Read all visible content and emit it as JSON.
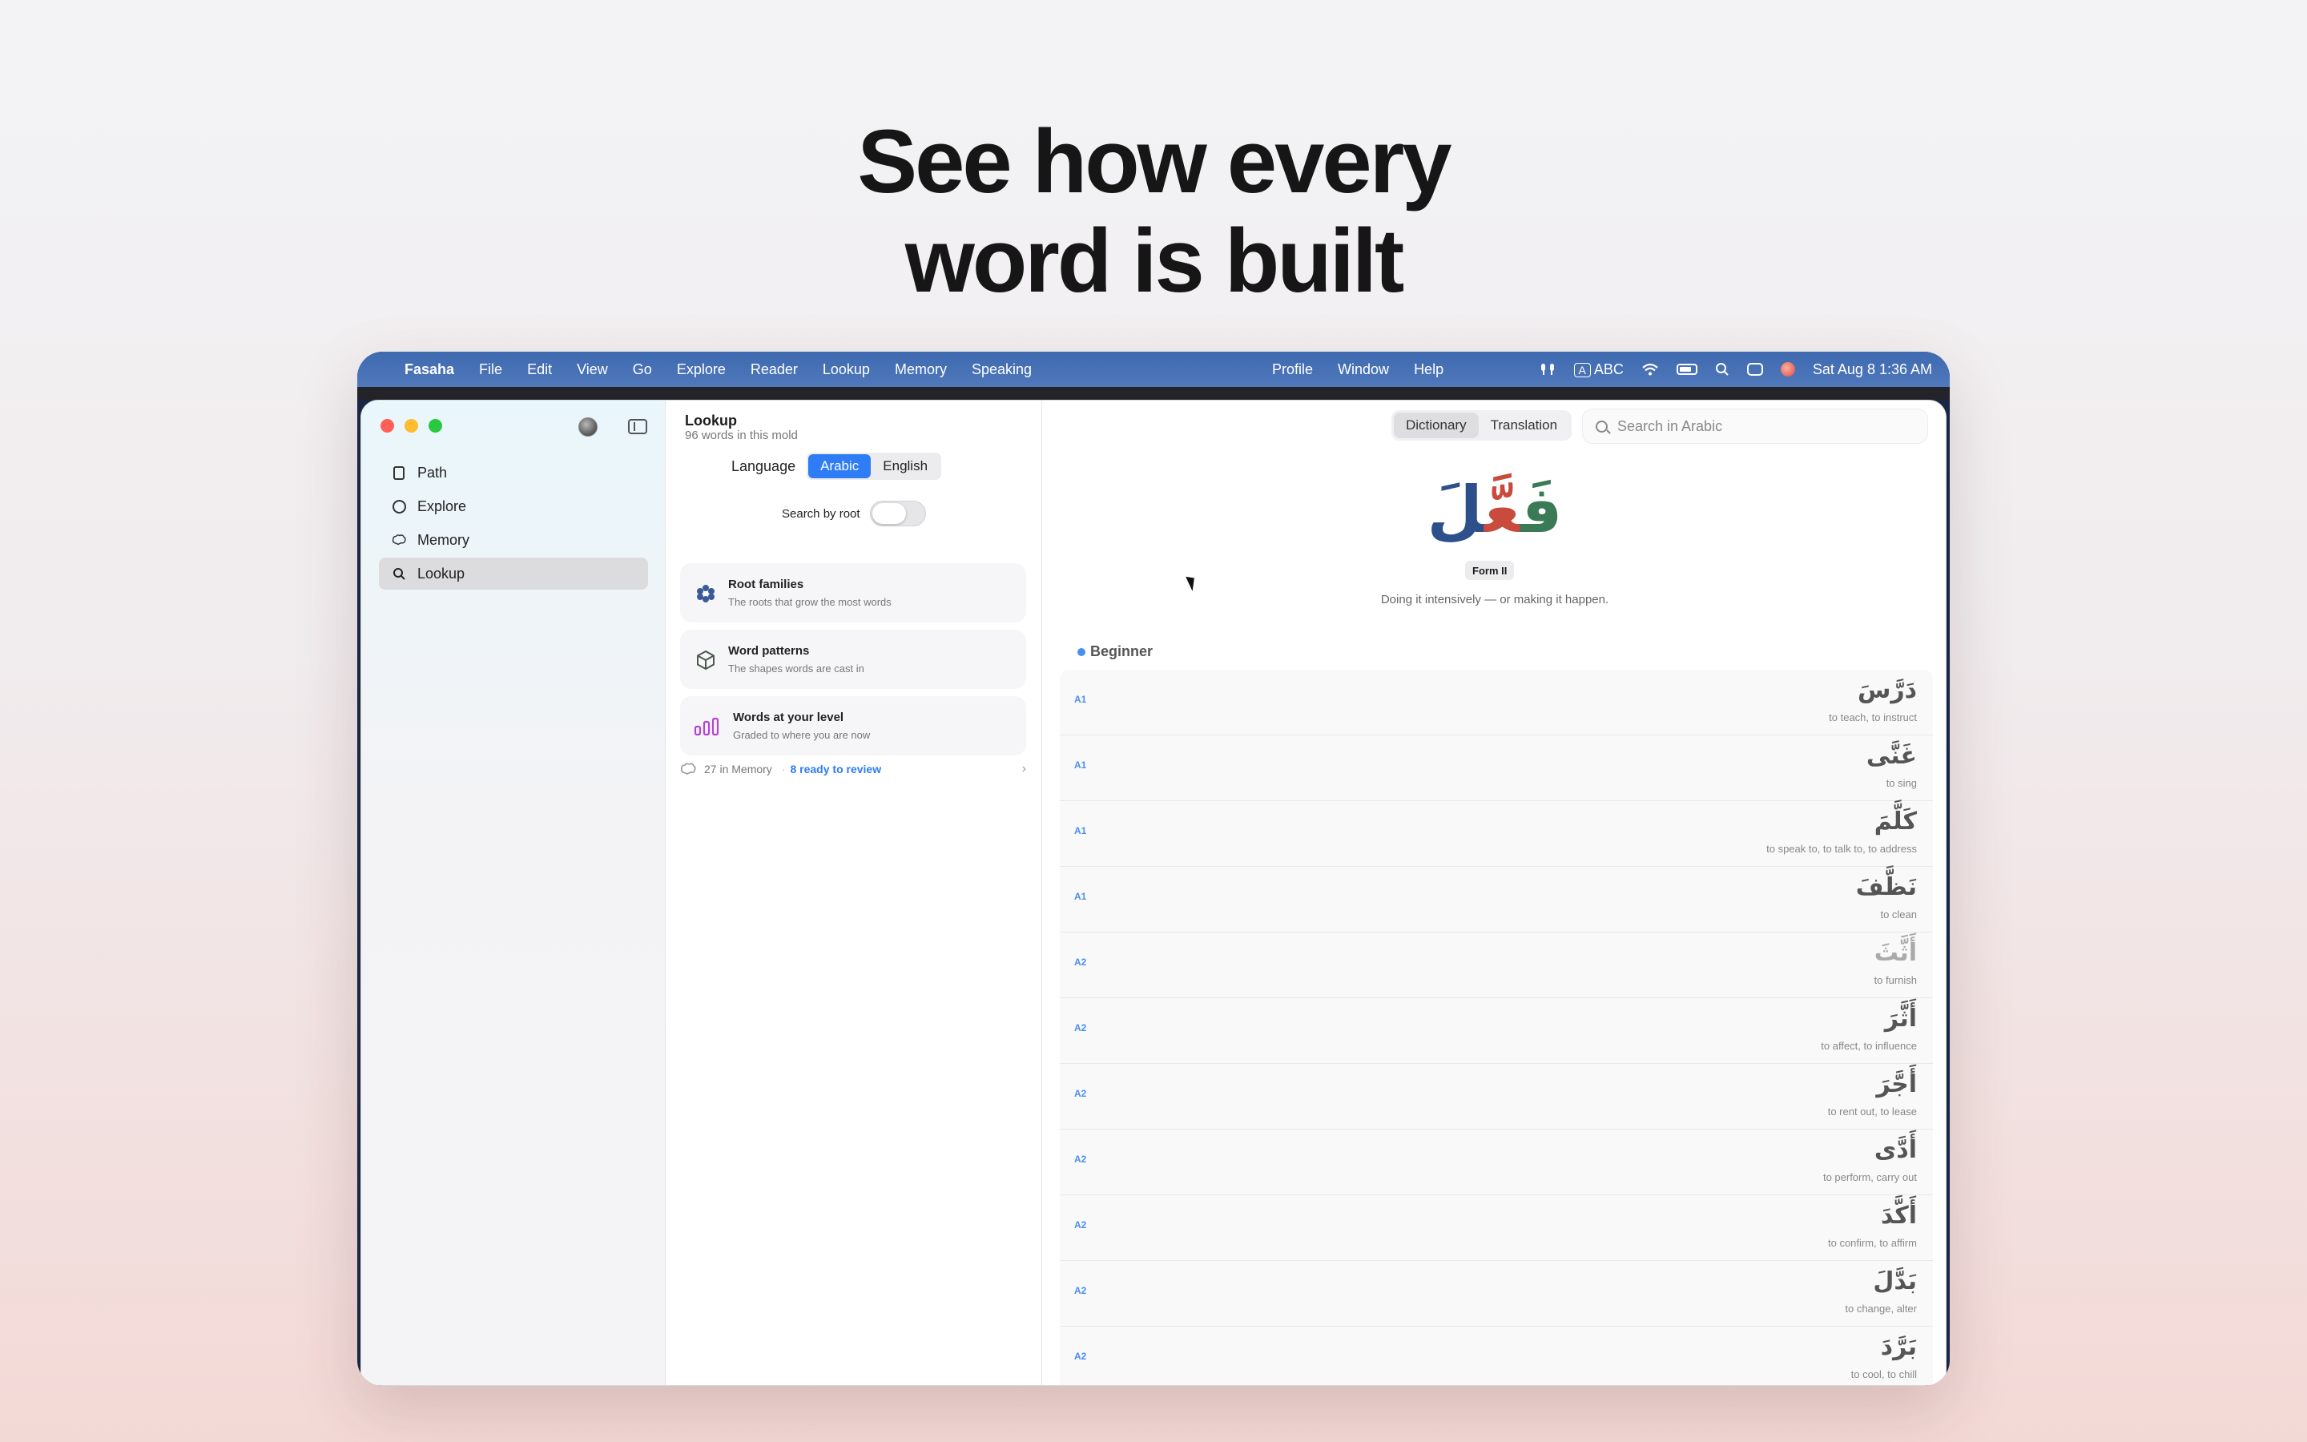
{
  "headline": {
    "line1": "See how every",
    "line2": "word is built"
  },
  "menubar": {
    "apple": "",
    "app_name": "Fasaha",
    "menus": [
      "File",
      "Edit",
      "View",
      "Go",
      "Explore",
      "Reader",
      "Lookup",
      "Memory",
      "Speaking"
    ],
    "right_menus": [
      "Profile",
      "Window",
      "Help"
    ],
    "input_source_box": "A",
    "input_source": "ABC",
    "datetime": "Sat Aug 8  1:36 AM"
  },
  "sidebar": {
    "items": [
      {
        "label": "Path",
        "icon": "book-icon"
      },
      {
        "label": "Explore",
        "icon": "compass-icon"
      },
      {
        "label": "Memory",
        "icon": "brain-icon"
      },
      {
        "label": "Lookup",
        "icon": "search-icon",
        "active": true
      }
    ]
  },
  "lookup": {
    "title": "Lookup",
    "subtitle": "96 words in this mold",
    "language_label": "Language",
    "language_options": [
      "Arabic",
      "English"
    ],
    "language_selected": "Arabic",
    "search_by_root_label": "Search by root",
    "search_by_root_on": false,
    "cards": [
      {
        "title": "Root families",
        "desc": "The roots that grow the most words",
        "icon": "flower-icon"
      },
      {
        "title": "Word patterns",
        "desc": "The shapes words are cast in",
        "icon": "cube-icon"
      },
      {
        "title": "Words at your level",
        "desc": "Graded to where you are now",
        "icon": "bar-chart-icon"
      }
    ],
    "memory_count": "27 in Memory",
    "ready_review": "8 ready to review"
  },
  "detail": {
    "tabs": [
      "Dictionary",
      "Translation"
    ],
    "active_tab": "Dictionary",
    "search_placeholder": "Search in Arabic",
    "hero": {
      "f": "فَ",
      "ain": "عَّ",
      "lam": "لَ"
    },
    "form_label": "Form II",
    "form_desc": "Doing it intensively — or making it happen.",
    "level_heading": "Beginner",
    "words": [
      {
        "level": "A1",
        "arabic": "دَرَّسَ",
        "english": "to teach, to instruct"
      },
      {
        "level": "A1",
        "arabic": "غَنَّى",
        "english": "to sing"
      },
      {
        "level": "A1",
        "arabic": "كَلَّمَ",
        "english": "to speak to, to talk to, to address"
      },
      {
        "level": "A1",
        "arabic": "نَظَّفَ",
        "english": "to clean"
      },
      {
        "level": "A2",
        "arabic": "أَثَّثَ",
        "english": "to furnish"
      },
      {
        "level": "A2",
        "arabic": "أَثَّرَ",
        "english": "to affect, to influence"
      },
      {
        "level": "A2",
        "arabic": "أَجَّرَ",
        "english": "to rent out, to lease"
      },
      {
        "level": "A2",
        "arabic": "أَدَّى",
        "english": "to perform, carry out"
      },
      {
        "level": "A2",
        "arabic": "أَكَّدَ",
        "english": "to confirm, to affirm"
      },
      {
        "level": "A2",
        "arabic": "بَدَّلَ",
        "english": "to change, alter"
      },
      {
        "level": "A2",
        "arabic": "بَرَّدَ",
        "english": "to cool, to chill"
      }
    ]
  },
  "colors": {
    "accent": "#2e7cf6",
    "root_f": "#3a7a56",
    "root_ain": "#c94b3d",
    "root_lam": "#2d4f8a"
  }
}
